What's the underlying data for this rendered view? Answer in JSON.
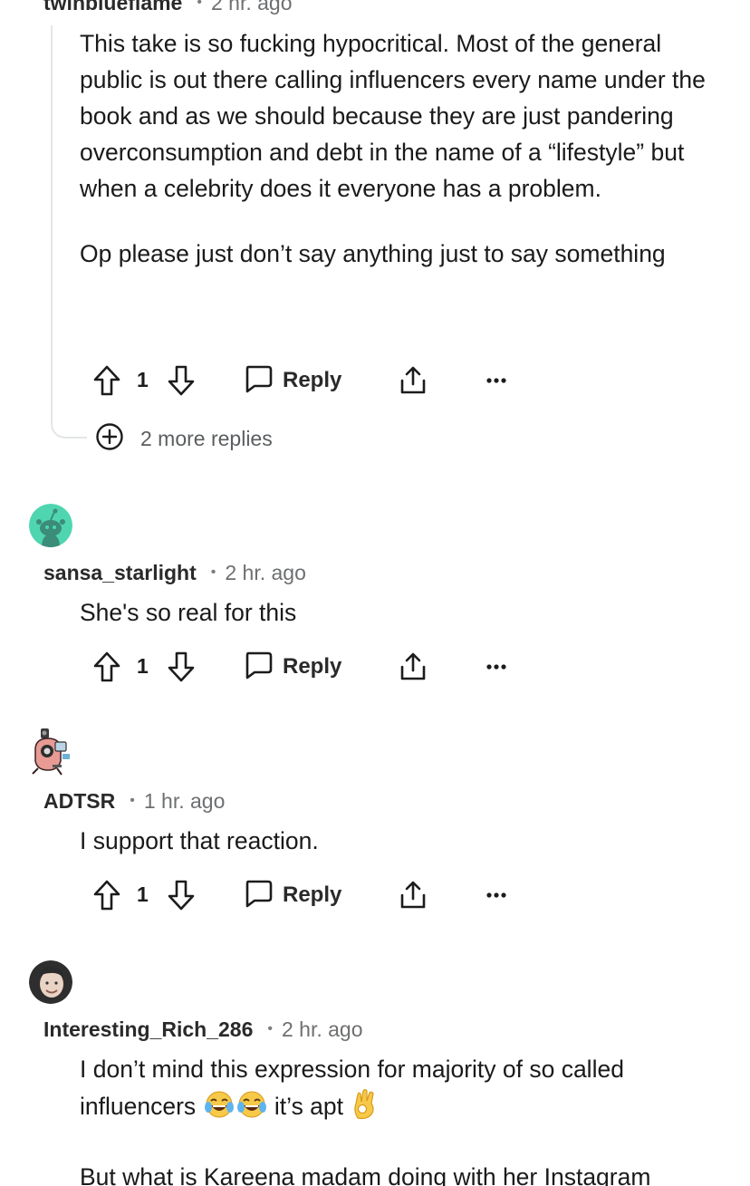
{
  "comments": [
    {
      "username": "twinblueflame",
      "time": "2 hr. ago",
      "paragraphs": [
        "This take is so fucking hypocritical. Most of the general public is out there calling influencers every name under the book and as we should because they are just pandering overconsumption and debt in the name of a “lifestyle” but when a celebrity does it everyone has a problem.",
        "Op please just don’t say anything just to say something"
      ],
      "votes": "1",
      "reply_label": "Reply",
      "more_replies": "2 more replies"
    },
    {
      "username": "sansa_starlight",
      "time": "2 hr. ago",
      "text": "She's so real for this",
      "votes": "1",
      "reply_label": "Reply"
    },
    {
      "username": "ADTSR",
      "time": "1 hr. ago",
      "text": "I support that reaction.",
      "votes": "1",
      "reply_label": "Reply"
    },
    {
      "username": "Interesting_Rich_286",
      "time": "2 hr. ago",
      "line1": "I don’t mind this expression for majority of so called",
      "line2_start": "influencers",
      "line2_mid": "it’s apt",
      "line3": "But what is Kareena madam doing with her Instagram"
    }
  ],
  "icons": {
    "upvote": "upvote-icon",
    "downvote": "downvote-icon",
    "reply": "chat-bubble-icon",
    "share": "share-icon",
    "more": "ellipsis-icon",
    "expand": "plus-circle-icon",
    "emoji_laugh": "tears-of-joy-emoji",
    "emoji_ok": "ok-hand-emoji"
  },
  "colors": {
    "text": "#1a1a1a",
    "meta": "#6d6f71",
    "thread_line": "#e3e6e8",
    "snoo_avatar_bg": "#4fd6b0"
  }
}
